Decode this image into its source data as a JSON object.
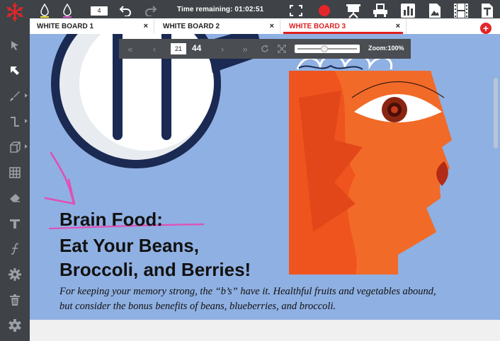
{
  "topbar": {
    "timer_label": "Time remaining: 01:02:51",
    "counter_value": "4",
    "pen_colors": [
      "#f5e43a",
      "#d055c6"
    ],
    "record_color": "#e3262b",
    "icons": [
      "ink-drop-icon",
      "ink-drop-icon",
      "undo-icon",
      "redo-icon",
      "fullscreen-icon",
      "record-icon",
      "presentation-icon",
      "projector-icon",
      "bar-chart-icon",
      "image-icon",
      "film-icon",
      "text-icon"
    ]
  },
  "tabs": [
    {
      "label": "WHITE BOARD 1",
      "close": "×",
      "active": false
    },
    {
      "label": "WHITE BOARD 2",
      "close": "×",
      "active": false
    },
    {
      "label": "WHITE BOARD 3",
      "close": "×",
      "active": true
    }
  ],
  "add_tab": "+",
  "pager": {
    "current_page": "21",
    "total_pages": "44",
    "zoom_label": "Zoom:100%",
    "zoom_level": 0.45
  },
  "sidebar": [
    "snowflake-logo",
    "select-arrow-icon",
    "pointer-arrow-icon",
    "brush-icon",
    "connector-icon",
    "cube-icon",
    "grid-icon",
    "eraser-icon",
    "text-tool-icon",
    "formula-icon",
    "gear-icon",
    "trash-icon",
    "settings-icon"
  ],
  "article": {
    "headline_1": "Brain Food:",
    "headline_2": "Eat Your Beans,",
    "headline_3": "Broccoli, and Berries!",
    "blurb_1": "For keeping your memory strong, the “b’s” have it. Healthful fruits and vegetables abound,",
    "blurb_2": "but consider the bonus benefits of beans, blueberries, and broccoli."
  },
  "colors": {
    "chrome": "#3f4347",
    "board_bg": "#8fb0e2",
    "accent": "#e02020",
    "annotation_pink": "#e14fb6",
    "face_orange": "#f0541e"
  }
}
